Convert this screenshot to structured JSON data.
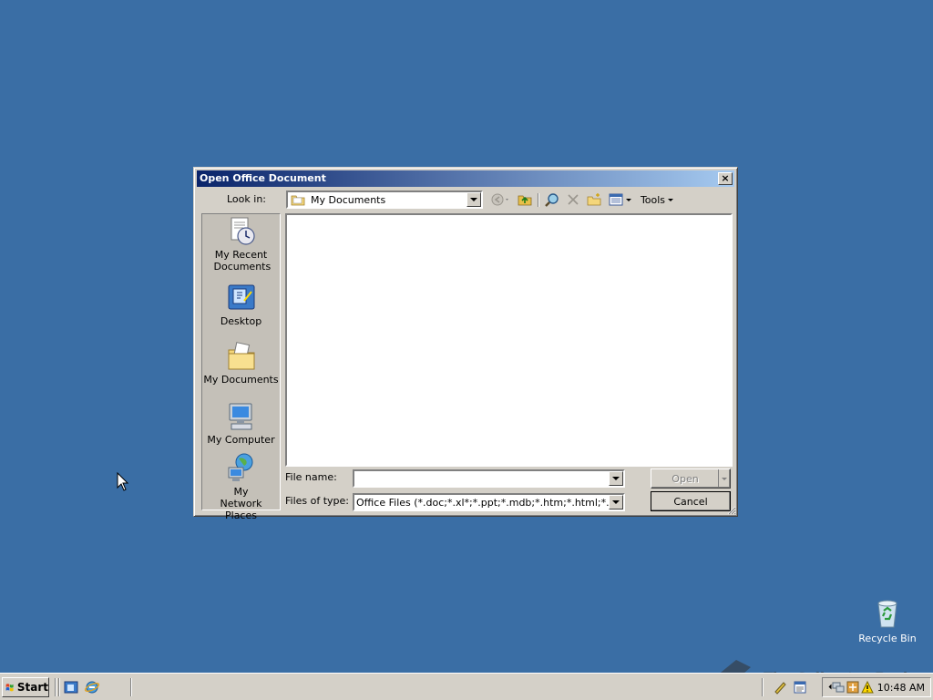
{
  "desktop": {
    "recycle_bin_label": "Recycle Bin",
    "watermark_text": "The Collection Book"
  },
  "dialog": {
    "title": "Open Office Document",
    "look_in_label": "Look in:",
    "look_in_value": "My Documents",
    "toolbar": {
      "tools_label": "Tools",
      "icons": [
        "back-icon",
        "up-folder-icon",
        "search-web-icon",
        "delete-icon",
        "new-folder-icon",
        "views-icon"
      ]
    },
    "places": [
      {
        "label": "My Recent Documents",
        "icon": "recent-documents-icon"
      },
      {
        "label": "Desktop",
        "icon": "desktop-icon"
      },
      {
        "label": "My Documents",
        "icon": "my-documents-icon"
      },
      {
        "label": "My Computer",
        "icon": "my-computer-icon"
      },
      {
        "label": "My Network Places",
        "icon": "network-places-icon"
      }
    ],
    "file_name_label": "File name:",
    "file_name_value": "",
    "files_of_type_label": "Files of type:",
    "files_of_type_value": "Office Files (*.doc;*.xl*;*.ppt;*.mdb;*.htm;*.html;*.mht",
    "open_button": "Open",
    "cancel_button": "Cancel",
    "close_button": "×"
  },
  "taskbar": {
    "start_label": "Start",
    "clock": "10:48 AM"
  },
  "colors": {
    "desktop": "#3a6ea5",
    "title_active": "#0a246a",
    "face": "#d4d0c8"
  }
}
